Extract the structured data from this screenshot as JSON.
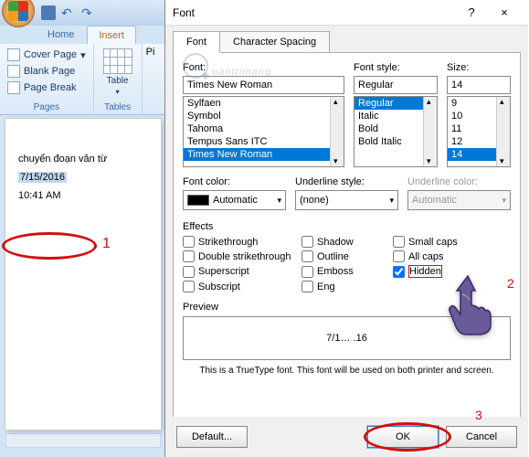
{
  "qat": {
    "save": "save",
    "undo": "undo",
    "redo": "redo"
  },
  "tabs": {
    "home": "Home",
    "insert": "Insert"
  },
  "ribbon": {
    "pages": {
      "cover": "Cover Page",
      "blank": "Blank Page",
      "break": "Page Break",
      "label": "Pages"
    },
    "tables": {
      "btn": "Table",
      "label": "Tables"
    },
    "pic": "Pi"
  },
  "doc": {
    "line1": "chuyển đoạn văn từ",
    "date": "7/15/2016",
    "time": "10:41 AM"
  },
  "annot": {
    "n1": "1",
    "n2": "2",
    "n3": "3"
  },
  "dialog": {
    "title": "Font",
    "help": "?",
    "close": "×",
    "tab_font": "Font",
    "tab_spacing": "Character Spacing",
    "font_label": "Font:",
    "font_value": "Times New Roman",
    "font_list": [
      "Sylfaen",
      "Symbol",
      "Tahoma",
      "Tempus Sans ITC",
      "Times New Roman"
    ],
    "style_label": "Font style:",
    "style_value": "Regular",
    "style_list": [
      "Regular",
      "Italic",
      "Bold",
      "Bold Italic"
    ],
    "size_label": "Size:",
    "size_value": "14",
    "size_list": [
      "9",
      "10",
      "11",
      "12",
      "14"
    ],
    "color_label": "Font color:",
    "color_value": "Automatic",
    "under_label": "Underline style:",
    "under_value": "(none)",
    "ucolor_label": "Underline color:",
    "ucolor_value": "Automatic",
    "effects_label": "Effects",
    "fx": {
      "strike": "Strikethrough",
      "dstrike": "Double strikethrough",
      "super": "Superscript",
      "sub": "Subscript",
      "shadow": "Shadow",
      "outline": "Outline",
      "emboss": "Emboss",
      "engrave": "Eng",
      "smallcaps": "Small caps",
      "allcaps": "All caps",
      "hidden": "Hidden"
    },
    "hidden_checked": true,
    "preview_label": "Preview",
    "preview_text": "7/1…  .16",
    "preview_note": "This is a TrueType font. This font will be used on both printer and screen.",
    "default_btn": "Default...",
    "ok_btn": "OK",
    "cancel_btn": "Cancel"
  },
  "watermark": "uantrimang"
}
